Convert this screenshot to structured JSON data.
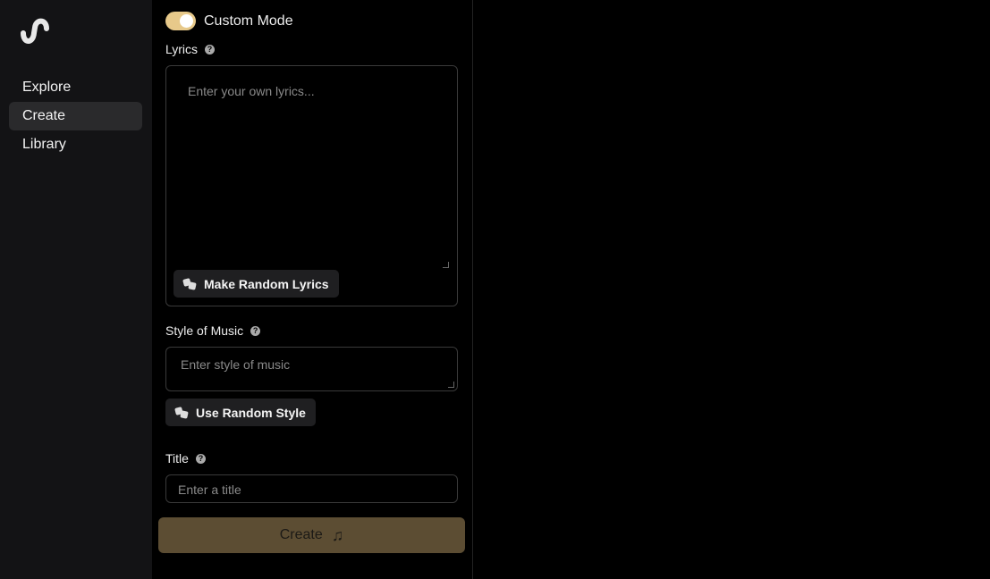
{
  "sidebar": {
    "items": [
      {
        "label": "Explore",
        "active": false
      },
      {
        "label": "Create",
        "active": true
      },
      {
        "label": "Library",
        "active": false
      }
    ]
  },
  "form": {
    "custom_mode": {
      "label": "Custom Mode",
      "enabled": true
    },
    "lyrics": {
      "label": "Lyrics",
      "placeholder": "Enter your own lyrics...",
      "random_button": "Make Random Lyrics"
    },
    "style": {
      "label": "Style of Music",
      "placeholder": "Enter style of music",
      "random_button": "Use Random Style"
    },
    "title": {
      "label": "Title",
      "placeholder": "Enter a title"
    },
    "create_button": "Create"
  },
  "colors": {
    "toggle_on": "#e7c98a",
    "create_button_bg": "#5c4d33",
    "sidebar_bg": "#131315"
  },
  "icons": [
    "logo-wave-icon",
    "help-icon",
    "dice-icon",
    "music-note-icon"
  ]
}
